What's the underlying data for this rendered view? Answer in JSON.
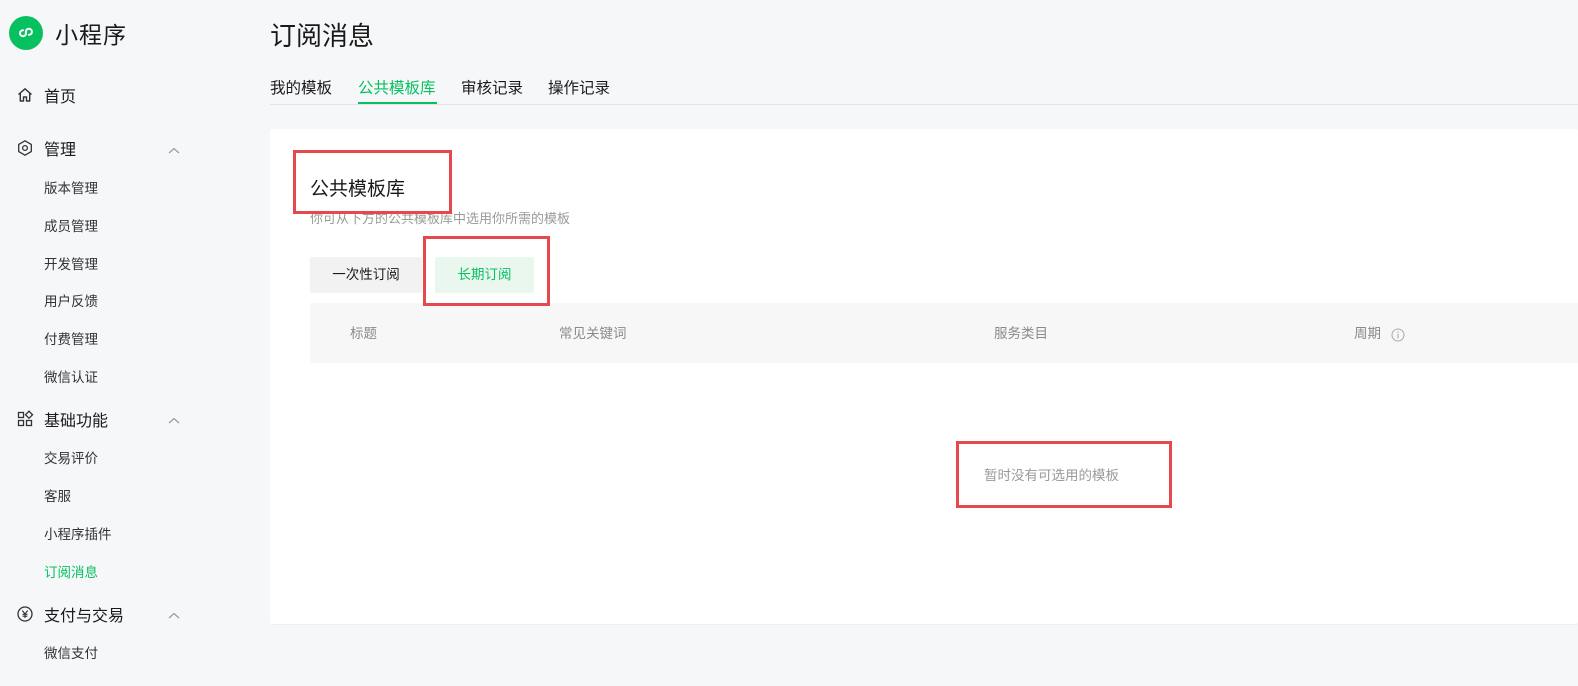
{
  "brand": {
    "name": "小程序",
    "accent": "#07c160",
    "highlight": "#e5484d"
  },
  "sidebar": {
    "home": {
      "label": "首页",
      "icon": "home-icon"
    },
    "sections": [
      {
        "label": "管理",
        "icon": "settings-hexagon-icon",
        "items": [
          "版本管理",
          "成员管理",
          "开发管理",
          "用户反馈",
          "付费管理",
          "微信认证"
        ]
      },
      {
        "label": "基础功能",
        "icon": "apps-grid-icon",
        "items": [
          "交易评价",
          "客服",
          "小程序插件",
          "订阅消息"
        ]
      },
      {
        "label": "支付与交易",
        "icon": "yuan-icon",
        "items": [
          "微信支付"
        ]
      }
    ],
    "active_item": "订阅消息"
  },
  "page": {
    "title": "订阅消息",
    "tabs": [
      "我的模板",
      "公共模板库",
      "审核记录",
      "操作记录"
    ],
    "active_tab": "公共模板库"
  },
  "card": {
    "title": "公共模板库",
    "description": "你可从下方的公共模板库中选用你所需的模板",
    "segments": [
      "一次性订阅",
      "长期订阅"
    ],
    "active_segment": "长期订阅",
    "table": {
      "columns": [
        "标题",
        "常见关键词",
        "服务类目",
        "周期"
      ]
    },
    "empty_text": "暂时没有可选用的模板"
  }
}
